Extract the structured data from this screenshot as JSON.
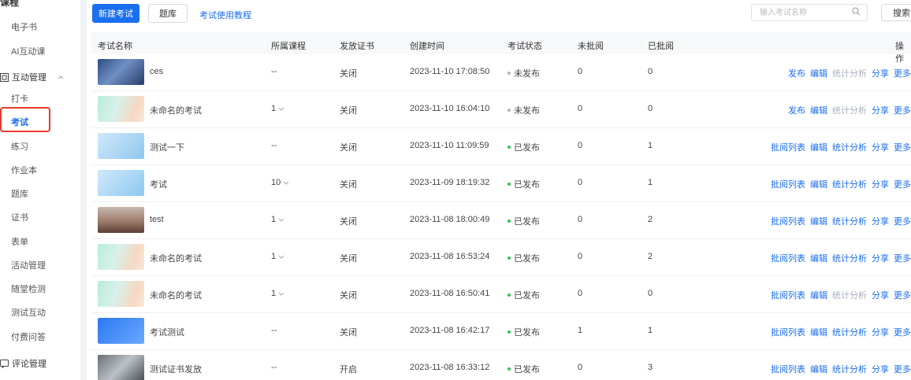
{
  "sidebar": {
    "top_label": "课程",
    "items_top": [
      "电子书",
      "AI互动课"
    ],
    "group_interactive": "互动管理",
    "items": [
      "打卡",
      "考试",
      "练习",
      "作业本",
      "题库",
      "证书",
      "表单",
      "活动管理",
      "随堂检测",
      "测试互动",
      "付费问答"
    ],
    "active_item": "考试",
    "group_comments": "评论管理"
  },
  "toolbar": {
    "new_exam_label": "新建考试",
    "question_bank_label": "题库",
    "tutorial_link": "考试使用教程",
    "search_placeholder": "输入考试名称",
    "search_button": "搜索"
  },
  "table": {
    "headers": [
      "考试名称",
      "所属课程",
      "发放证书",
      "创建时间",
      "考试状态",
      "未批阅",
      "已批阅",
      "操作"
    ],
    "rows": [
      {
        "thumb": "photo",
        "name": "ces",
        "course": "--",
        "course_dropdown": false,
        "cert": "关闭",
        "created": "2023-11-10 17:08:50",
        "status": "未发布",
        "unread": "0",
        "read": "0",
        "actions": [
          {
            "label": "发布",
            "enabled": true
          },
          {
            "label": "编辑",
            "enabled": true
          },
          {
            "label": "统计分析",
            "enabled": false
          },
          {
            "label": "分享",
            "enabled": true
          },
          {
            "label": "更多",
            "enabled": true
          }
        ]
      },
      {
        "thumb": "pastel",
        "name": "未命名的考试",
        "course": "1",
        "course_dropdown": true,
        "cert": "关闭",
        "created": "2023-11-10 16:04:10",
        "status": "未发布",
        "unread": "0",
        "read": "0",
        "actions": [
          {
            "label": "发布",
            "enabled": true
          },
          {
            "label": "编辑",
            "enabled": true
          },
          {
            "label": "统计分析",
            "enabled": false
          },
          {
            "label": "分享",
            "enabled": true
          },
          {
            "label": "更多",
            "enabled": true
          }
        ]
      },
      {
        "thumb": "doraemon",
        "name": "测试一下",
        "course": "--",
        "course_dropdown": false,
        "cert": "关闭",
        "created": "2023-11-10 11:09:59",
        "status": "已发布",
        "unread": "0",
        "read": "1",
        "actions": [
          {
            "label": "批阅列表",
            "enabled": true
          },
          {
            "label": "编辑",
            "enabled": true
          },
          {
            "label": "统计分析",
            "enabled": true
          },
          {
            "label": "分享",
            "enabled": true
          },
          {
            "label": "更多",
            "enabled": true
          }
        ]
      },
      {
        "thumb": "doraemon2",
        "name": "考试",
        "course": "10",
        "course_dropdown": true,
        "cert": "关闭",
        "created": "2023-11-09 18:19:32",
        "status": "已发布",
        "unread": "0",
        "read": "1",
        "actions": [
          {
            "label": "批阅列表",
            "enabled": true
          },
          {
            "label": "编辑",
            "enabled": true
          },
          {
            "label": "统计分析",
            "enabled": true
          },
          {
            "label": "分享",
            "enabled": true
          },
          {
            "label": "更多",
            "enabled": true
          }
        ]
      },
      {
        "thumb": "brown",
        "name": "test",
        "course": "1",
        "course_dropdown": true,
        "cert": "关闭",
        "created": "2023-11-08 18:00:49",
        "status": "已发布",
        "unread": "0",
        "read": "2",
        "actions": [
          {
            "label": "批阅列表",
            "enabled": true
          },
          {
            "label": "编辑",
            "enabled": true
          },
          {
            "label": "统计分析",
            "enabled": true
          },
          {
            "label": "分享",
            "enabled": true
          },
          {
            "label": "更多",
            "enabled": true
          }
        ]
      },
      {
        "thumb": "pastel",
        "name": "未命名的考试",
        "course": "1",
        "course_dropdown": true,
        "cert": "关闭",
        "created": "2023-11-08 16:53:24",
        "status": "已发布",
        "unread": "0",
        "read": "2",
        "actions": [
          {
            "label": "批阅列表",
            "enabled": true
          },
          {
            "label": "编辑",
            "enabled": true
          },
          {
            "label": "统计分析",
            "enabled": true
          },
          {
            "label": "分享",
            "enabled": true
          },
          {
            "label": "更多",
            "enabled": true
          }
        ]
      },
      {
        "thumb": "pastel",
        "name": "未命名的考试",
        "course": "1",
        "course_dropdown": true,
        "cert": "关闭",
        "created": "2023-11-08 16:50:41",
        "status": "已发布",
        "unread": "0",
        "read": "0",
        "actions": [
          {
            "label": "批阅列表",
            "enabled": true
          },
          {
            "label": "编辑",
            "enabled": true
          },
          {
            "label": "统计分析",
            "enabled": false
          },
          {
            "label": "分享",
            "enabled": true
          },
          {
            "label": "更多",
            "enabled": true
          }
        ]
      },
      {
        "thumb": "banner",
        "name": "考试测试",
        "course": "--",
        "course_dropdown": false,
        "cert": "关闭",
        "created": "2023-11-08 16:42:17",
        "status": "已发布",
        "unread": "1",
        "read": "1",
        "actions": [
          {
            "label": "批阅列表",
            "enabled": true
          },
          {
            "label": "编辑",
            "enabled": true
          },
          {
            "label": "统计分析",
            "enabled": true
          },
          {
            "label": "分享",
            "enabled": true
          },
          {
            "label": "更多",
            "enabled": true
          }
        ]
      },
      {
        "thumb": "gray",
        "name": "测试证书发放",
        "course": "--",
        "course_dropdown": false,
        "cert": "开启",
        "created": "2023-11-08 16:33:12",
        "status": "已发布",
        "unread": "0",
        "read": "3",
        "actions": [
          {
            "label": "批阅列表",
            "enabled": true
          },
          {
            "label": "编辑",
            "enabled": true
          },
          {
            "label": "统计分析",
            "enabled": true
          },
          {
            "label": "分享",
            "enabled": true
          },
          {
            "label": "更多",
            "enabled": true
          }
        ]
      }
    ]
  },
  "colors": {
    "accent": "#1a6ef0",
    "published_dot": "#2fc25b",
    "unpublished_dot": "#b5b5b5",
    "disabled_action": "#aab0bc",
    "highlight_border": "#e8382b"
  },
  "icons": {
    "search": "search-icon",
    "interactive": "interactive-icon",
    "comments": "comment-icon",
    "collapse": "chevron-up-icon",
    "dropdown": "chevron-down-icon"
  }
}
